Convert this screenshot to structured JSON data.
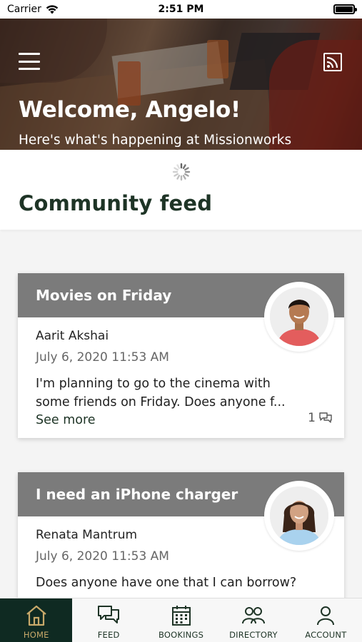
{
  "status_bar": {
    "carrier": "Carrier",
    "time": "2:51 PM"
  },
  "hero": {
    "title": "Welcome, Angelo!",
    "subtitle": "Here's what's happening at Missionworks"
  },
  "feed": {
    "title": "Community feed"
  },
  "posts": [
    {
      "title": "Movies on Friday",
      "author": "Aarit Akshai",
      "date": "July 6, 2020 11:53 AM",
      "text": "I'm planning to go to the cinema with some friends on Friday. Does anyone f...",
      "see_more": "See more",
      "comments": "1"
    },
    {
      "title": "I need an iPhone charger",
      "author": "Renata Mantrum",
      "date": "July 6, 2020 11:53 AM",
      "text": "Does anyone have one that I can borrow?"
    }
  ],
  "tabs": [
    {
      "label": "HOME",
      "icon": "home-icon",
      "active": true
    },
    {
      "label": "FEED",
      "icon": "chat-bubbles-icon"
    },
    {
      "label": "BOOKINGS",
      "icon": "calendar-icon"
    },
    {
      "label": "DIRECTORY",
      "icon": "people-icon"
    },
    {
      "label": "ACCOUNT",
      "icon": "person-icon"
    }
  ],
  "colors": {
    "brand_dark": "#0f2a22",
    "brand_text": "#1e3426",
    "active_tab_text": "#c8a96a",
    "card_header": "#7b7b7b"
  }
}
